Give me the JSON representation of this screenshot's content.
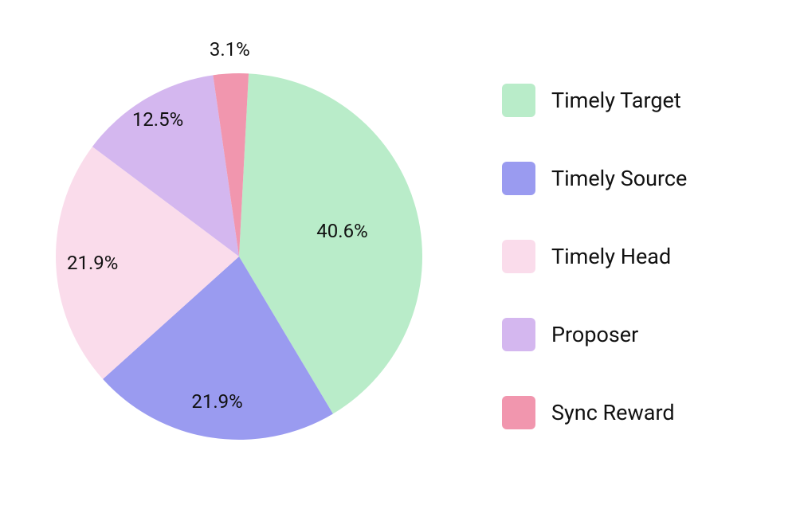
{
  "chart_data": {
    "type": "pie",
    "series": [
      {
        "name": "Timely Target",
        "value": 40.6,
        "label": "40.6%",
        "color": "#b9ecc9"
      },
      {
        "name": "Timely Source",
        "value": 21.9,
        "label": "21.9%",
        "color": "#9a9bf0"
      },
      {
        "name": "Timely Head",
        "value": 21.9,
        "label": "21.9%",
        "color": "#fadceb"
      },
      {
        "name": "Proposer",
        "value": 12.5,
        "label": "12.5%",
        "color": "#d4b7ef"
      },
      {
        "name": "Sync Reward",
        "value": 3.1,
        "label": "3.1%",
        "color": "#f196ae"
      }
    ]
  }
}
